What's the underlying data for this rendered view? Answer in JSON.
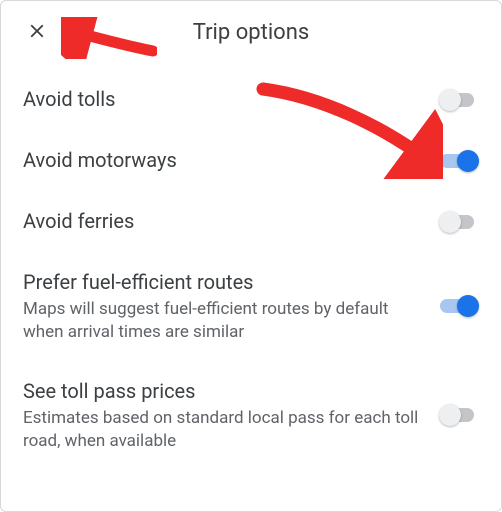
{
  "header": {
    "title": "Trip options"
  },
  "options": [
    {
      "label": "Avoid tolls",
      "description": null,
      "on": false
    },
    {
      "label": "Avoid motorways",
      "description": null,
      "on": true
    },
    {
      "label": "Avoid ferries",
      "description": null,
      "on": false
    },
    {
      "label": "Prefer fuel-efficient routes",
      "description": "Maps will suggest fuel-efficient routes by default when arrival times are similar",
      "on": true
    },
    {
      "label": "See toll pass prices",
      "description": "Estimates based on standard local pass for each toll road, when available",
      "on": false
    }
  ],
  "colors": {
    "accent": "#1a73e8",
    "arrow": "#ee2b29"
  }
}
